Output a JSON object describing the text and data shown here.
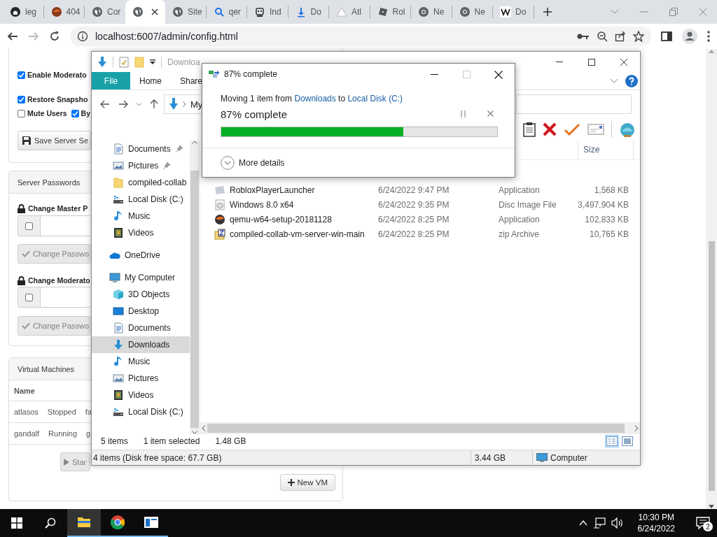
{
  "browser": {
    "tabs": [
      {
        "kind": "cat",
        "label": "leg",
        "selected": false
      },
      {
        "kind": "ball",
        "label": "404",
        "selected": false
      },
      {
        "kind": "globe",
        "label": "Cor",
        "selected": false
      },
      {
        "kind": "globe",
        "selected": true
      },
      {
        "kind": "globe",
        "label": "Site",
        "selected": false
      },
      {
        "kind": "magnifier",
        "label": "qer",
        "selected": false
      },
      {
        "kind": "robot",
        "label": "Ind",
        "selected": false
      },
      {
        "kind": "download",
        "label": "Do",
        "selected": false
      },
      {
        "kind": "triangle",
        "label": "Atl",
        "selected": false
      },
      {
        "kind": "tile",
        "label": "Rol",
        "selected": false
      },
      {
        "kind": "wheel",
        "label": "Ne",
        "selected": false
      },
      {
        "kind": "wheel",
        "label": "Ne",
        "selected": false
      },
      {
        "kind": "letter",
        "label": "Do",
        "selected": false
      }
    ],
    "address": "localhost:6007/admin/config.html"
  },
  "page": {
    "option_rows": [
      [
        {
          "label": "Enable Moderato",
          "checked": true
        }
      ],
      [
        {
          "label": "Restore Snapsho",
          "checked": true
        }
      ],
      [
        {
          "label": "Mute Users",
          "checked": false
        },
        {
          "label": "By",
          "checked": true
        }
      ]
    ],
    "save_button": "Save Server Se",
    "passwords_panel": {
      "title": "Server Passwords",
      "sections": [
        {
          "label": "Change Master P",
          "checked": false,
          "button": "Change Passwo",
          "disabled": true
        },
        {
          "label": "Change Moderato",
          "checked": false,
          "button": "Change Passwo",
          "disabled": true
        }
      ]
    },
    "vm_panel": {
      "title": "Virtual Machines",
      "columns": [
        "Name"
      ],
      "rows": [
        [
          "atlasos",
          "Stopped",
          "fa"
        ],
        [
          "gandalf",
          "Running",
          "g"
        ]
      ],
      "start_button": "Star",
      "new_button": "New VM"
    }
  },
  "explorer": {
    "title": "Downloa",
    "ribbon_tabs": [
      {
        "label": "File",
        "selected": true
      },
      {
        "label": "Home",
        "selected": false
      },
      {
        "label": "Share",
        "selected": false
      }
    ],
    "address_crumbs": [
      "My"
    ],
    "nav": {
      "quick_access": [
        {
          "kind": "documents",
          "label": "Documents",
          "pinned": true,
          "selected": false
        },
        {
          "kind": "pictures",
          "label": "Pictures",
          "pinned": true,
          "selected": false
        },
        {
          "kind": "folder",
          "label": "compiled-collab",
          "pinned": false,
          "selected": false
        },
        {
          "kind": "drive",
          "label": "Local Disk (C:)",
          "pinned": false,
          "selected": false
        },
        {
          "kind": "music",
          "label": "Music",
          "pinned": false,
          "selected": false
        },
        {
          "kind": "videos",
          "label": "Videos",
          "pinned": false,
          "selected": false
        }
      ],
      "locations": [
        {
          "kind": "cloud",
          "label": "OneDrive",
          "selected": false
        },
        {
          "kind": "computer",
          "label": "My Computer",
          "selected": false,
          "children": [
            {
              "kind": "objects",
              "label": "3D Objects",
              "selected": false
            },
            {
              "kind": "desktop",
              "label": "Desktop",
              "selected": false
            },
            {
              "kind": "documents",
              "label": "Documents",
              "selected": false
            },
            {
              "kind": "downloads",
              "label": "Downloads",
              "selected": true
            },
            {
              "kind": "music",
              "label": "Music",
              "selected": false
            },
            {
              "kind": "pictures",
              "label": "Pictures",
              "selected": false
            },
            {
              "kind": "videos",
              "label": "Videos",
              "selected": false
            },
            {
              "kind": "drive",
              "label": "Local Disk (C:)",
              "selected": false
            }
          ]
        }
      ]
    },
    "columns": [
      "Size"
    ],
    "files": [
      {
        "kind": "launcher",
        "name": "RobloxPlayerLauncher",
        "date": "6/24/2022 9:47 PM",
        "type": "Application",
        "size": "1,568 KB"
      },
      {
        "kind": "disc",
        "name": "Windows 8.0 x64",
        "date": "6/24/2022 9:35 PM",
        "type": "Disc Image File",
        "size": "3,497,904 KB"
      },
      {
        "kind": "installer",
        "name": "qemu-w64-setup-20181128",
        "date": "6/24/2022 8:25 PM",
        "type": "Application",
        "size": "102,833 KB"
      },
      {
        "kind": "archive",
        "name": "compiled-collab-vm-server-win-main",
        "date": "6/24/2022 8:25 PM",
        "type": "zip Archive",
        "size": "10,765 KB"
      }
    ],
    "status": {
      "count": "5 items",
      "selection": "1 item selected",
      "size": "1.48 GB"
    },
    "views": [
      {
        "kind": "details",
        "selected": true
      },
      {
        "kind": "preview",
        "selected": false
      }
    ],
    "bottom_bar": {
      "summary": "4 items (Disk free space: 67.7 GB)",
      "size": "3.44 GB",
      "location": "Computer"
    }
  },
  "dialog": {
    "title": "87% complete",
    "message": [
      {
        "kind": "text",
        "text": "Moving 1 item from "
      },
      {
        "kind": "link",
        "text": "Downloads"
      },
      {
        "kind": "text",
        "text": " to "
      },
      {
        "kind": "link",
        "text": "Local Disk (C:)"
      }
    ],
    "heading": "87% complete",
    "progress": {
      "level": 0.66
    },
    "details": "More details"
  },
  "taskbar": {
    "apps": [
      {
        "kind": "explorer",
        "selected": true
      },
      {
        "kind": "chrome",
        "selected": false
      },
      {
        "kind": "window",
        "selected": false
      }
    ],
    "time": "10:30 PM",
    "date": "6/24/2022",
    "notifications": "2"
  }
}
